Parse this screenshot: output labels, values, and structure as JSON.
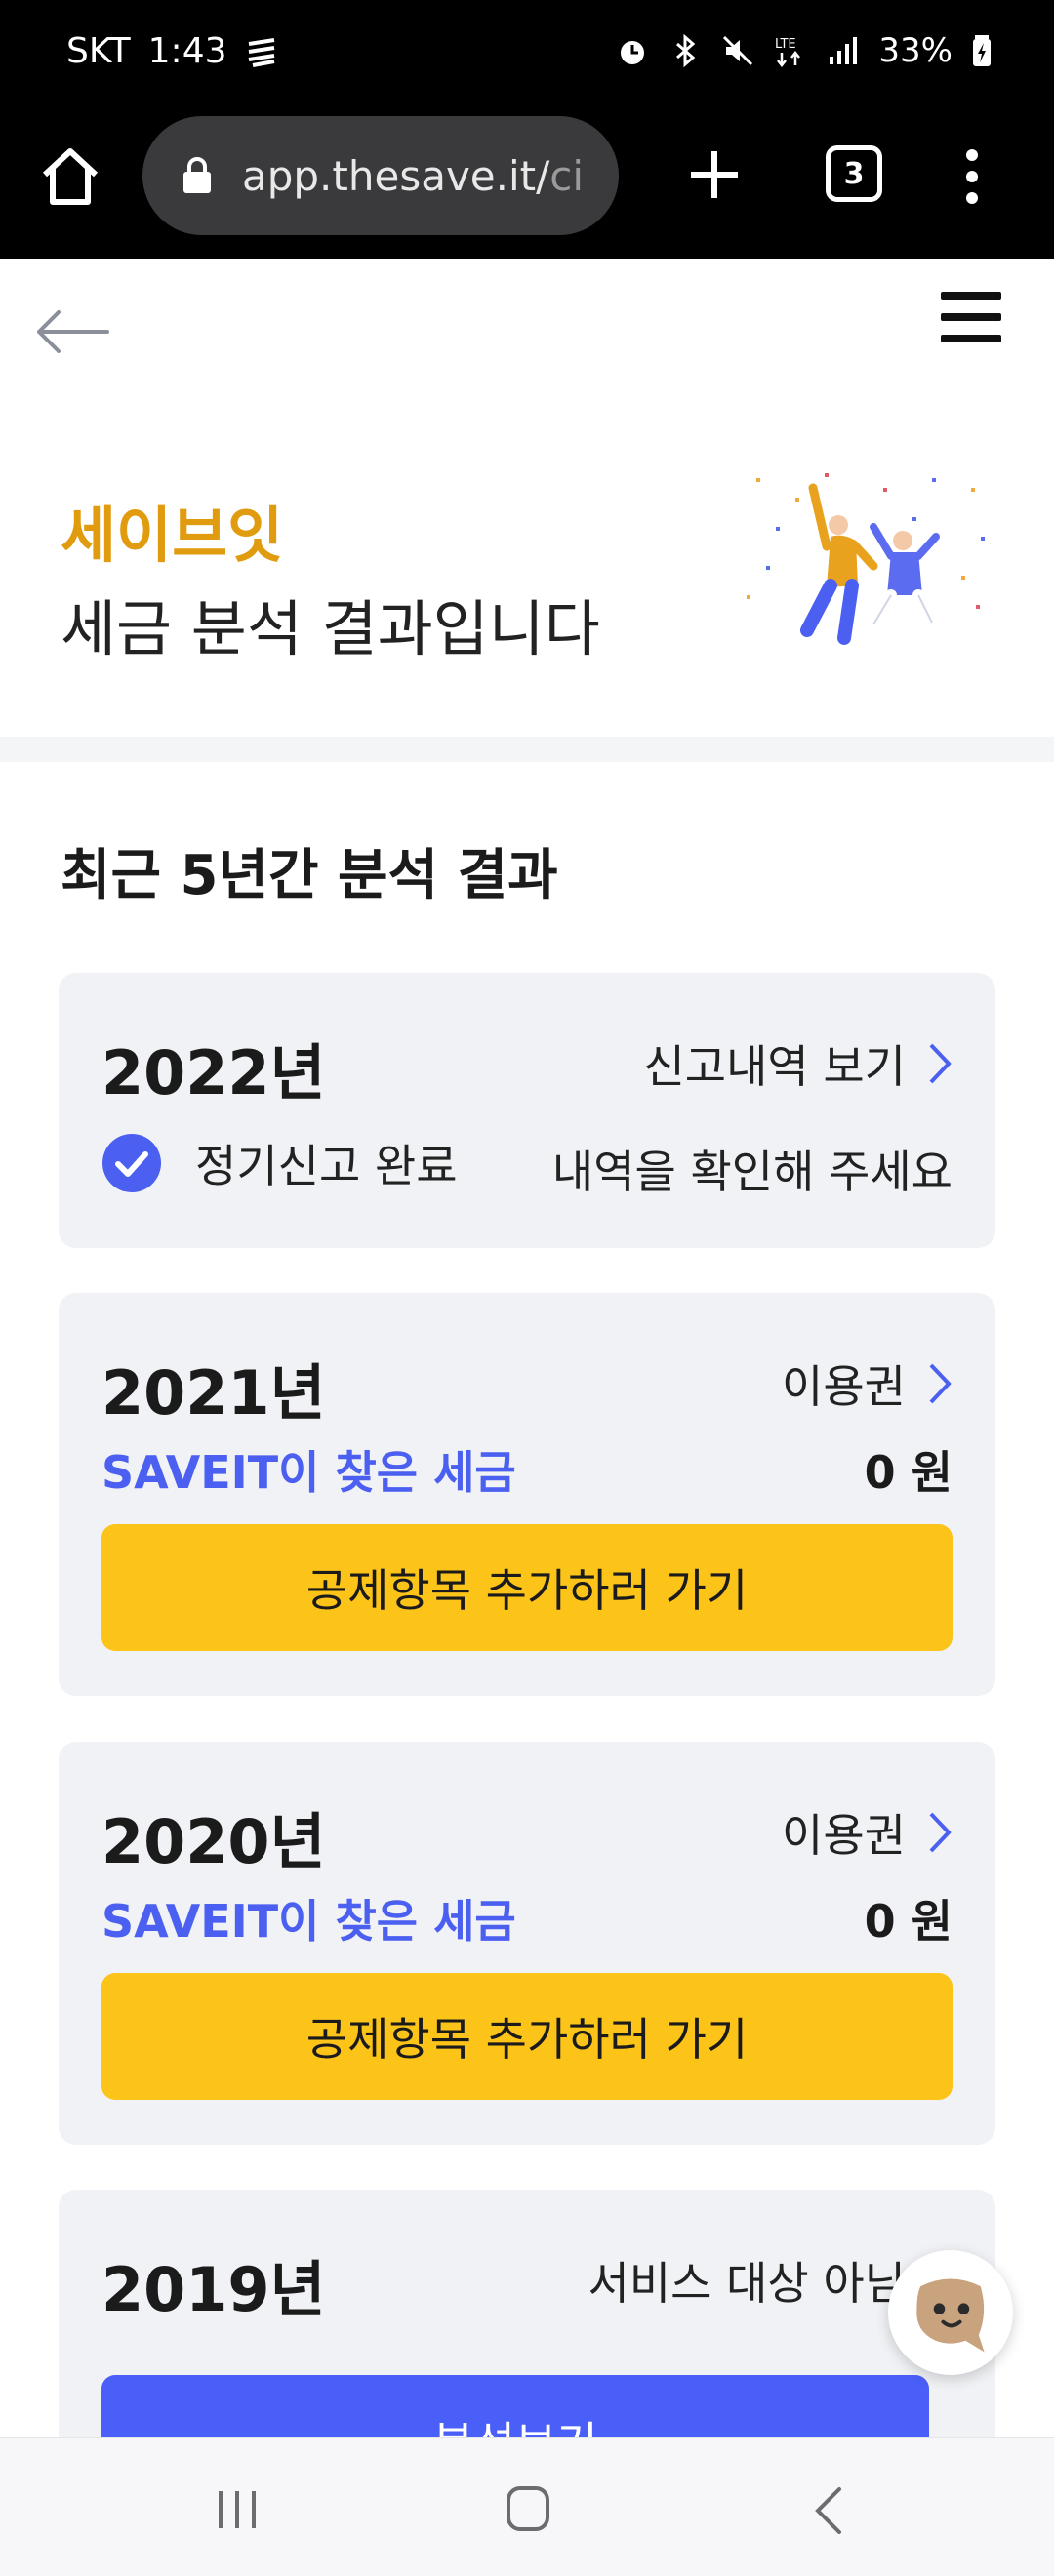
{
  "status_bar": {
    "carrier": "SKT",
    "time": "1:43",
    "battery": "33%"
  },
  "browser": {
    "url_main": "app.thesave.it/",
    "url_rest": "ci",
    "tab_count": "3"
  },
  "hero": {
    "brand": "세이브잇",
    "subtitle": "세금 분석 결과입니다"
  },
  "section_title": "최근 5년간 분석 결과",
  "cards": [
    {
      "year": "2022년",
      "link": "신고내역 보기",
      "status": "정기신고 완료",
      "note": "내역을 확인해 주세요"
    },
    {
      "year": "2021년",
      "link": "이용권",
      "found_label": "SAVEIT이 찾은 세금",
      "amount": "0 원",
      "button": "공제항목 추가하러 가기"
    },
    {
      "year": "2020년",
      "link": "이용권",
      "found_label": "SAVEIT이 찾은 세금",
      "amount": "0 원",
      "button": "공제항목 추가하러 가기"
    },
    {
      "year": "2019년",
      "link": "서비스 대상 아님",
      "button": "분석보기"
    }
  ],
  "colors": {
    "brand": "#e19b0f",
    "accent_blue": "#4b5ff0",
    "button_yellow": "#fcc419",
    "card_bg": "#f0f2f5"
  }
}
